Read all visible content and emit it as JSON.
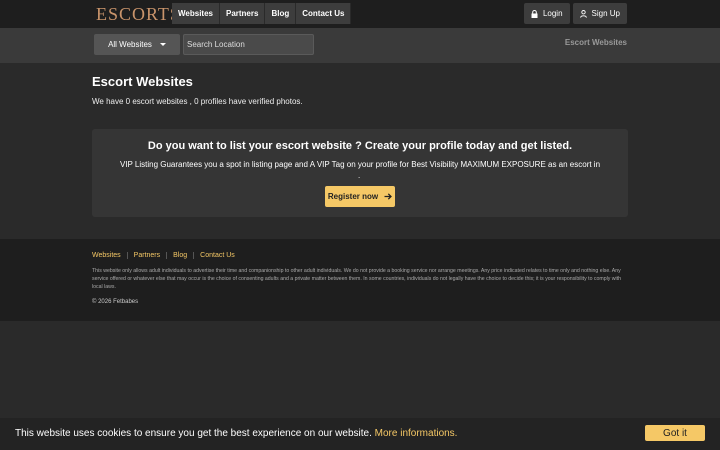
{
  "header": {
    "logo": "ESCORTS",
    "nav": [
      "Websites",
      "Partners",
      "Blog",
      "Contact Us"
    ],
    "login_label": "Login",
    "signup_label": "Sign Up"
  },
  "search": {
    "dropdown_value": "All Websites",
    "placeholder": "Search Location",
    "breadcrumb": "Escort Websites"
  },
  "main": {
    "heading": "Escort Websites",
    "summary": "We have 0 escort websites , 0 profiles have verified photos."
  },
  "promo": {
    "title": "Do you want to list your escort website ? Create your profile today and get listed.",
    "text": "VIP Listing Guarantees you a spot in listing page and A VIP Tag on your profile for Best Visibility MAXIMUM EXPOSURE as an escort in",
    "dot": ".",
    "button_label": "Register now"
  },
  "footer": {
    "links": [
      "Websites",
      "Partners",
      "Blog",
      "Contact Us"
    ],
    "disclaimer": "This website only allows adult individuals to advertise their time and companionship to other adult individuals. We do not provide a booking service nor arrange meetings. Any price indicated relates to time only and nothing else. Any service offered or whatever else that may occur is the choice of consenting adults and a private matter between them. In some countries, individuals do not legally have the choice to decide this; it is your responsibility to comply with local laws.",
    "copyright": "© 2026 Fetbabes"
  },
  "cookie": {
    "text": "This website uses cookies to ensure you get the best experience on our website.",
    "link": "More informations.",
    "button": "Got it"
  },
  "colors": {
    "accent": "#f5c866",
    "logo": "#c9946b"
  }
}
